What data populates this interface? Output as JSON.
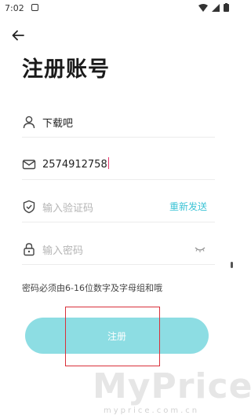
{
  "status_bar": {
    "time": "7:02"
  },
  "title": "注册账号",
  "fields": {
    "username": {
      "value": "下载吧"
    },
    "email": {
      "value": "2574912758"
    },
    "verification": {
      "placeholder": "输入验证码",
      "resend_label": "重新发送"
    },
    "password": {
      "placeholder": "输入密码"
    }
  },
  "hint": "密码必须由6-16位数字及字母组和哦",
  "register_button": {
    "label": "注册"
  },
  "watermark": {
    "logo": "MyPrice",
    "url": "myprice.com.cn"
  },
  "colors": {
    "accent": "#3ec4d6",
    "button": "#8ddde3",
    "highlight_box": "#d9303a"
  }
}
